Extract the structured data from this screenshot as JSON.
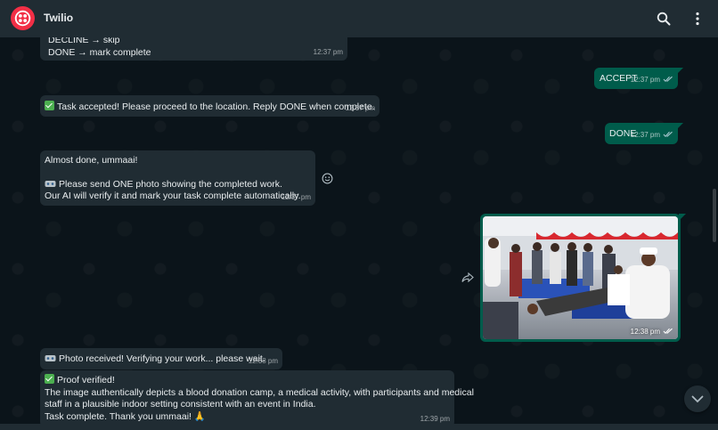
{
  "header": {
    "title": "Twilio",
    "icons": [
      "twilio-logo-icon",
      "search-icon",
      "more-vertical-icon"
    ]
  },
  "messages": [
    {
      "direction": "incoming",
      "lines": [
        "DECLINE → skip",
        "DONE → mark complete"
      ],
      "time": "12:37 pm"
    },
    {
      "direction": "outgoing",
      "text": "ACCEPT",
      "time": "12:37 pm",
      "status": "read"
    },
    {
      "direction": "incoming",
      "emoji": "check-mark-icon",
      "text": "Task accepted! Please proceed to the location. Reply DONE when complete.",
      "time": "12:37 pm"
    },
    {
      "direction": "outgoing",
      "text": "DONE",
      "time": "12:37 pm",
      "status": "read"
    },
    {
      "direction": "incoming",
      "line1": "Almost done, ummaai!",
      "line2": "Please send ONE photo showing the completed work.",
      "line3": "Our AI will verify it and mark your task complete automatically.",
      "time": "12:37 pm"
    },
    {
      "direction": "outgoing",
      "type": "photo",
      "time": "12:38 pm",
      "status": "read"
    },
    {
      "direction": "incoming",
      "emoji": "robot-icon",
      "text": "Photo received! Verifying your work... please wait.",
      "time": "12:38 pm"
    },
    {
      "direction": "incoming",
      "heading": "Proof verified!",
      "lines": [
        "The image authentically depicts a blood donation camp, a medical activity, with participants and medical",
        "staff in a plausible indoor setting consistent with an event in India.",
        "Task complete. Thank you ummaai! 🙏"
      ],
      "time": "12:39 pm"
    }
  ],
  "colors": {
    "header_bg": "#202c33",
    "chat_bg": "#0b141a",
    "incoming_bubble": "#202c33",
    "outgoing_bubble": "#005c4b",
    "brand": "#f22f46"
  }
}
